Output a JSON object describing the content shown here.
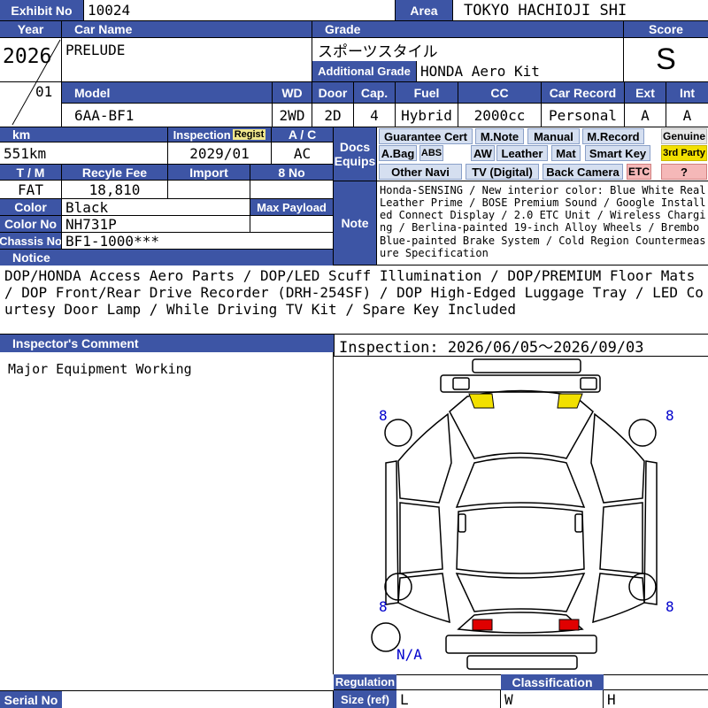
{
  "header": {
    "exhibit_label": "Exhibit No",
    "exhibit_no": "10024",
    "area_label": "Area",
    "area": "TOKYO HACHIOJI SHI",
    "year_label": "Year",
    "carname_label": "Car Name",
    "grade_label": "Grade",
    "score_label": "Score",
    "year": "2026",
    "month": "01",
    "car_name": "PRELUDE",
    "grade": "スポーツスタイル",
    "addgrade_label": "Additional Grade",
    "add_grade": "HONDA Aero Kit",
    "score": "S"
  },
  "model_row": {
    "labels": {
      "model": "Model",
      "wd": "WD",
      "door": "Door",
      "cap": "Cap.",
      "fuel": "Fuel",
      "cc": "CC",
      "record": "Car Record",
      "ext": "Ext",
      "int": "Int"
    },
    "values": {
      "model": "6AA-BF1",
      "wd": "2WD",
      "door": "2D",
      "cap": "4",
      "fuel": "Hybrid",
      "cc": "2000cc",
      "record": "Personal",
      "ext": "A",
      "int": "A"
    }
  },
  "specs": {
    "km_label": "km",
    "km": "551km",
    "inspection_label": "Inspection",
    "regist_badge": "Regist",
    "inspection": "2029/01",
    "ac_label": "A / C",
    "ac": "AC",
    "tm_label": "T / M",
    "tm": "FAT",
    "recycle_label": "Recyle Fee",
    "recycle": "18,810",
    "import_label": "Import",
    "no8_label": "8 No",
    "color_label": "Color",
    "color": "Black",
    "maxpayload_label": "Max Payload",
    "colorno_label": "Color No",
    "color_no": "NH731P",
    "chassis_label": "Chassis No",
    "chassis": "BF1-1000***"
  },
  "docs": {
    "label_line1": "Docs",
    "label_line2": "Equips",
    "items": {
      "guarantee": "Guarantee Cert",
      "mnote": "M.Note",
      "manual": "Manual",
      "mrecord": "M.Record",
      "genuine": "Genuine",
      "abag": "A.Bag",
      "abs": "ABS",
      "aw": "AW",
      "leather": "Leather",
      "mat": "Mat",
      "smartkey": "Smart Key",
      "thirdparty": "3rd Party",
      "othernavi": "Other Navi",
      "tvdigital": "TV (Digital)",
      "backcamera": "Back Camera",
      "etc": "ETC",
      "question": "?"
    }
  },
  "note": {
    "label": "Note",
    "text": "Honda-SENSING / New interior color: Blue White Real Leather Prime / BOSE Premium Sound / Google Installed Connect Display / 2.0 ETC Unit / Wireless Charging / Berlina-painted 19-inch Alloy Wheels / Brembo Blue-painted Brake System / Cold Region Countermeasure Specification"
  },
  "notice": {
    "label": "Notice",
    "text": "DOP/HONDA Access Aero Parts / DOP/LED Scuff Illumination / DOP/PREMIUM Floor Mats / DOP Front/Rear Drive Recorder (DRH-254SF) / DOP High-Edged Luggage Tray / LED Courtesy Door Lamp / While Driving TV Kit / Spare Key Included"
  },
  "inspector": {
    "label": "Inspector's Comment",
    "comment": "Major Equipment Working",
    "inspection_period": "Inspection: 2026/06/05～2026/09/03"
  },
  "diagram": {
    "tire_fl": "8",
    "tire_fr": "8",
    "tire_rl": "8",
    "tire_rr": "8",
    "spare": "N/A",
    "colors": {
      "front_lights": "#f2e000",
      "rear_lights": "#e00000",
      "tire_numbers": "#0000cc"
    }
  },
  "footer": {
    "serial_label": "Serial No",
    "regulation_label": "Regulation",
    "size_label": "Size (ref)",
    "classification_label": "Classification",
    "size_l": "L",
    "size_w": "W",
    "size_h": "H"
  }
}
